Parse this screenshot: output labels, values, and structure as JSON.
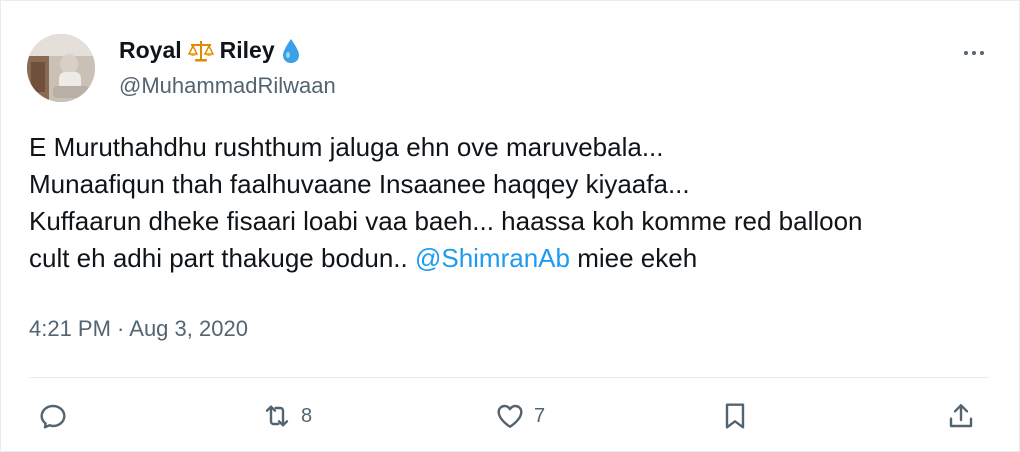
{
  "user": {
    "display_name_first": "Royal",
    "display_name_last": "Riley",
    "badge_icon": "balance-scale-icon",
    "drop_icon": "water-drop-icon",
    "handle": "@MuhammadRilwaan"
  },
  "tweet": {
    "line1": "E Muruthahdhu rushthum jaluga ehn ove maruvebala...",
    "line2": "Munaafiqun thah faalhuvaane Insaanee haqqey kiyaafa...",
    "line3": "Kuffaarun dheke fisaari loabi vaa baeh... haassa koh komme red balloon",
    "line4_before": "cult eh adhi part thakuge bodun.. ",
    "mention": "@ShimranAb",
    "line4_after": " miee ekeh",
    "timestamp": "4:21 PM · Aug 3, 2020"
  },
  "actions": {
    "reply_icon": "reply-icon",
    "retweet_icon": "retweet-icon",
    "retweet_count": "8",
    "like_icon": "heart-icon",
    "like_count": "7",
    "bookmark_icon": "bookmark-icon",
    "share_icon": "share-icon"
  },
  "colors": {
    "text": "#0f1419",
    "secondary": "#536471",
    "accent": "#1d9bf0",
    "drop": "#1d9bf0"
  }
}
